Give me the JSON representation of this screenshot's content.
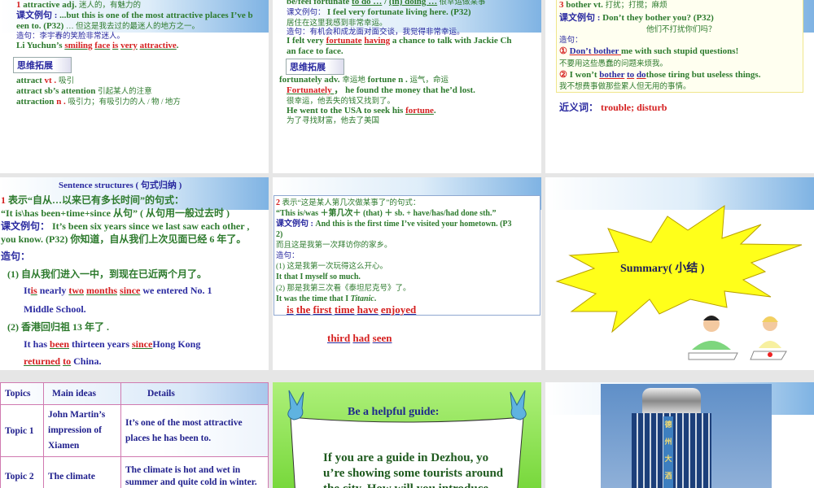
{
  "slide1": {
    "lines": [
      [
        {
          "t": "1 ",
          "k": "r"
        },
        {
          "t": "attractive  adj.  ",
          "k": "g"
        },
        {
          "t": "迷人的，有魅力的",
          "k": "gs"
        }
      ],
      [
        {
          "t": "课文例句 : ",
          "k": "b"
        },
        {
          "t": "...but this is one of the most attractive places I’ve b",
          "k": "g"
        }
      ],
      [
        {
          "t": "een to.  (P32)     ",
          "k": "g"
        },
        {
          "t": "… 但这是我去过的最迷人的地方之一。",
          "k": "gs"
        }
      ],
      [
        {
          "t": "造句：李宇春的笑脸非常迷人。",
          "k": "bs"
        }
      ],
      [
        {
          "t": "Li Yuchun’s ",
          "k": "g"
        },
        {
          "t": "smiling",
          "k": "ru"
        },
        {
          "t": " ",
          "k": "g"
        },
        {
          "t": "face",
          "k": "ru"
        },
        {
          "t": " ",
          "k": "g"
        },
        {
          "t": "is",
          "k": "ru"
        },
        {
          "t": " ",
          "k": "g"
        },
        {
          "t": "very",
          "k": "ru"
        },
        {
          "t": " ",
          "k": "g"
        },
        {
          "t": "attractive",
          "k": "ru"
        },
        {
          "t": ".",
          "k": "g"
        }
      ],
      [
        {
          "t": "attract  ",
          "k": "g"
        },
        {
          "t": "vt .  ",
          "k": "r"
        },
        {
          "t": "吸引",
          "k": "gs"
        }
      ],
      [
        {
          "t": "attract sb’s attention  ",
          "k": "g"
        },
        {
          "t": "引起某人的注意",
          "k": "gs"
        }
      ],
      [
        {
          "t": "attraction  ",
          "k": "g"
        },
        {
          "t": "n .  ",
          "k": "r"
        },
        {
          "t": "吸引力；有吸引力的人 / 物 / 地方",
          "k": "gs"
        }
      ]
    ],
    "badge": "思维拓展"
  },
  "slide2": {
    "lines": [
      [
        {
          "t": "be/feel fortunate ",
          "k": "g"
        },
        {
          "t": "to do …",
          "k": "gu"
        },
        {
          "t": " / ",
          "k": "g"
        },
        {
          "t": "(in) doing …",
          "k": "gu"
        },
        {
          "t": " 很幸运做某事",
          "k": "gs"
        }
      ],
      [
        {
          "t": "课文例句： ",
          "k": "bs"
        },
        {
          "t": "I feel very fortunate living here.  (P32)",
          "k": "g"
        }
      ],
      [
        {
          "t": "居住在这里我感到非常幸运。",
          "k": "gs"
        }
      ],
      [
        {
          "t": "造句：有机会和成龙面对面交谈，我觉得非常幸运。",
          "k": "bs"
        }
      ],
      [
        {
          "t": "I felt very ",
          "k": "g"
        },
        {
          "t": "fortunate",
          "k": "ru"
        },
        {
          "t": " ",
          "k": "g"
        },
        {
          "t": "having",
          "k": "ru"
        },
        {
          "t": " a chance to talk with Jackie Ch",
          "k": "g"
        }
      ],
      [
        {
          "t": "an face to face.",
          "k": "g"
        }
      ],
      [
        {
          "t": "fortunately  adv.  ",
          "k": "g"
        },
        {
          "t": "幸运地",
          "k": "gs"
        },
        {
          "t": "            fortune  n .  ",
          "k": "g"
        },
        {
          "t": "运气，命运",
          "k": "gs"
        }
      ],
      [
        {
          "t": " Fortunately ",
          "k": "ru"
        },
        {
          "t": " ，  he found the money that he’d lost.",
          "k": "g"
        }
      ],
      [
        {
          "t": "很幸运，他丢失的钱又找到了。",
          "k": "gs"
        }
      ],
      [
        {
          "t": "He went to the USA to seek his ",
          "k": "g"
        },
        {
          "t": "fortune",
          "k": "ru"
        },
        {
          "t": ".",
          "k": "g"
        }
      ],
      [
        {
          "t": "为了寻找财富，他去了美国",
          "k": "gs"
        }
      ]
    ],
    "badge": "思维拓展"
  },
  "slide3": {
    "lines": [
      [
        {
          "t": "3 ",
          "k": "r"
        },
        {
          "t": "bother  vt.  ",
          "k": "g"
        },
        {
          "t": "打扰；打搅；麻烦",
          "k": "gs"
        }
      ],
      [
        {
          "t": "课文例句 : ",
          "k": "b"
        },
        {
          "t": "Don’t they bother you?  (P32)",
          "k": "g"
        }
      ],
      [
        {
          "t": "他们不打扰你们吗？",
          "k": "gs"
        }
      ],
      [
        {
          "t": "造句：",
          "k": "bs"
        }
      ],
      [
        {
          "t": "① ",
          "k": "r"
        },
        {
          "t": " Don’t bother ",
          "k": "bu"
        },
        {
          "t": " me with such stupid questions!",
          "k": "g"
        }
      ],
      [
        {
          "t": "不要用这些愚蠢的问题来烦我。",
          "k": "gs"
        }
      ],
      [
        {
          "t": "② ",
          "k": "r"
        },
        {
          "t": "I won’t ",
          "k": "g"
        },
        {
          "t": "bother",
          "k": "bu"
        },
        {
          "t": " ",
          "k": "g"
        },
        {
          "t": "to",
          "k": "bu"
        },
        {
          "t": " ",
          "k": "g"
        },
        {
          "t": "do",
          "k": "bu"
        },
        {
          "t": "those tiring but useless things.",
          "k": "g"
        }
      ],
      [
        {
          "t": "我不想费事做那些累人但无用的事情。",
          "k": "gs"
        }
      ]
    ],
    "synonyms": [
      {
        "t": "近义词：  ",
        "k": "b"
      },
      {
        "t": "trouble;  disturb",
        "k": "r"
      }
    ]
  },
  "slide4": {
    "title": "Sentence structures ( 句式归纳 )",
    "lines": [
      [
        {
          "t": "1  ",
          "k": "r"
        },
        {
          "t": "表示“自从…以来已有多长时间”的句式：",
          "k": "g"
        }
      ],
      [
        {
          "t": "  “It is\\has been+time+since 从句”    ( 从句用一般过去时 )",
          "k": "g"
        }
      ],
      [
        {
          "t": "课文例句： ",
          "k": "b"
        },
        {
          "t": "It’s been six years since we last saw each other ,",
          "k": "g"
        }
      ],
      [
        {
          "t": "you know. (P32)  你知道，自从我们上次见面已经 6 年了。",
          "k": "g"
        }
      ],
      [
        {
          "t": " 造句：",
          "k": "b"
        }
      ],
      [
        {
          "t": "(1)  自从我们进入一中，到现在已近两个月了。",
          "k": "g"
        }
      ],
      [
        {
          "t": "It",
          "k": "b"
        },
        {
          "t": "is",
          "k": "ru"
        },
        {
          "t": " nearly ",
          "k": "b"
        },
        {
          "t": "two",
          "k": "ru"
        },
        {
          "t": " ",
          "k": "b"
        },
        {
          "t": "months",
          "k": "ru"
        },
        {
          "t": " ",
          "k": "b"
        },
        {
          "t": "since",
          "k": "ru"
        },
        {
          "t": " we entered No. 1",
          "k": "b"
        }
      ],
      [
        {
          "t": "Middle School.",
          "k": "b"
        }
      ],
      [
        {
          "t": "(2)  香港回归祖           13 年了 .",
          "k": "g"
        }
      ],
      [
        {
          "t": "It has ",
          "k": "b"
        },
        {
          "t": "been",
          "k": "ru"
        },
        {
          "t": " thirteen years ",
          "k": "b"
        },
        {
          "t": "since",
          "k": "ru"
        },
        {
          "t": "Hong Kong",
          "k": "b"
        }
      ],
      [
        {
          "t": "returned",
          "k": "ru"
        },
        {
          "t": " ",
          "k": "b"
        },
        {
          "t": "to",
          "k": "ru"
        },
        {
          "t": " China.",
          "k": "b"
        }
      ]
    ]
  },
  "slide5": {
    "lines": [
      [
        {
          "t": "2  ",
          "k": "r"
        },
        {
          "t": "表示“这是某人第几次做某事了”的句式：",
          "k": "gs"
        }
      ],
      [
        {
          "t": "“This is/was ＋第几次＋ (that) ＋ sb. + have/has/had done sth.”",
          "k": "g"
        }
      ],
      [
        {
          "t": "课文例句 : ",
          "k": "b"
        },
        {
          "t": "And this is the first time I’ve visited your hometown. (P3",
          "k": "g"
        }
      ],
      [
        {
          "t": "2)",
          "k": "g"
        }
      ],
      [
        {
          "t": "而且这是我第一次拜访你的家乡。",
          "k": "gs"
        }
      ],
      [
        {
          "t": "造句：",
          "k": "bs"
        }
      ],
      [
        {
          "t": "(1)  这是我第一次玩得这么开心。",
          "k": "gs"
        }
      ],
      [
        {
          "t": "It                        that I                       myself so much.",
          "k": "g"
        }
      ],
      [
        {
          "t": "(2)  那是我第三次看《泰坦尼克号》了。",
          "k": "gs"
        }
      ],
      [
        {
          "t": "It was the          time that I                   ",
          "k": "g"
        },
        {
          "t": "Titanic",
          "k": "g"
        },
        {
          "t": ".",
          "k": "g"
        }
      ]
    ],
    "answers1": [
      {
        "t": "is",
        "k": "rb"
      },
      {
        "t": " ",
        "k": "r"
      },
      {
        "t": "the",
        "k": "rb"
      },
      {
        "t": " ",
        "k": "r"
      },
      {
        "t": "first",
        "k": "rb"
      },
      {
        "t": " ",
        "k": "r"
      },
      {
        "t": "time",
        "k": "rb"
      },
      {
        "t": "           ",
        "k": "r"
      },
      {
        "t": "have",
        "k": "rb"
      },
      {
        "t": " ",
        "k": "r"
      },
      {
        "t": "enjoyed",
        "k": "rb"
      }
    ],
    "answers2": [
      {
        "t": "third",
        "k": "rb"
      },
      {
        "t": "                  ",
        "k": "r"
      },
      {
        "t": "had",
        "k": "rb"
      },
      {
        "t": " ",
        "k": "r"
      },
      {
        "t": "seen",
        "k": "rb"
      }
    ]
  },
  "slide6": {
    "title": "Summary( 小结 )"
  },
  "slide7": {
    "headers": [
      "Topics",
      "Main ideas",
      "Details"
    ],
    "rows": [
      [
        "Topic 1",
        "John Martin’s impression of Xiamen",
        "It’s one of the most attractive places he has been to."
      ],
      [
        "Topic 2",
        "The climate",
        "The climate is hot and wet in summer and quite cold in winter."
      ]
    ]
  },
  "slide8": {
    "title": "Be a helpful guide:",
    "body": "If you are a guide in Dezhou, you’re showing some tourists around the city. How will you introduce..."
  },
  "slide9": {
    "sign": "德州大酒店"
  }
}
